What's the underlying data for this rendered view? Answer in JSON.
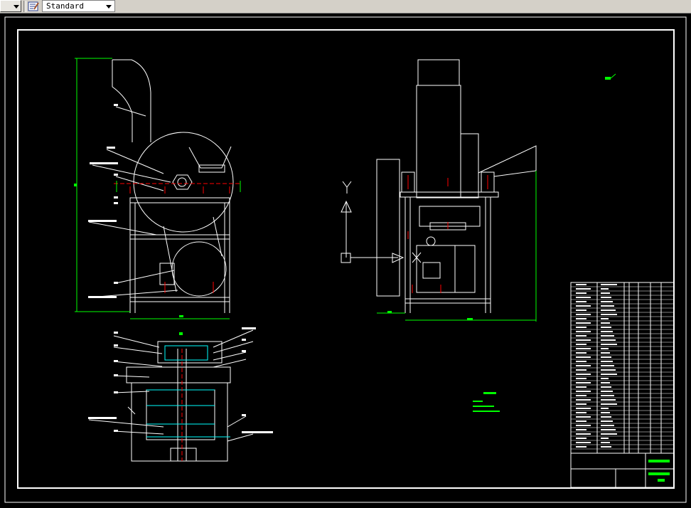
{
  "toolbar": {
    "text_style": "Standard",
    "icons": [
      "dropdown-arrow-icon",
      "text-style-icon",
      "chevron-down-icon"
    ]
  },
  "colors": {
    "background": "#000000",
    "lines": "#ffffff",
    "dimensions": "#00ff00",
    "centerlines": "#ff0000",
    "accent": "#00ffff"
  }
}
